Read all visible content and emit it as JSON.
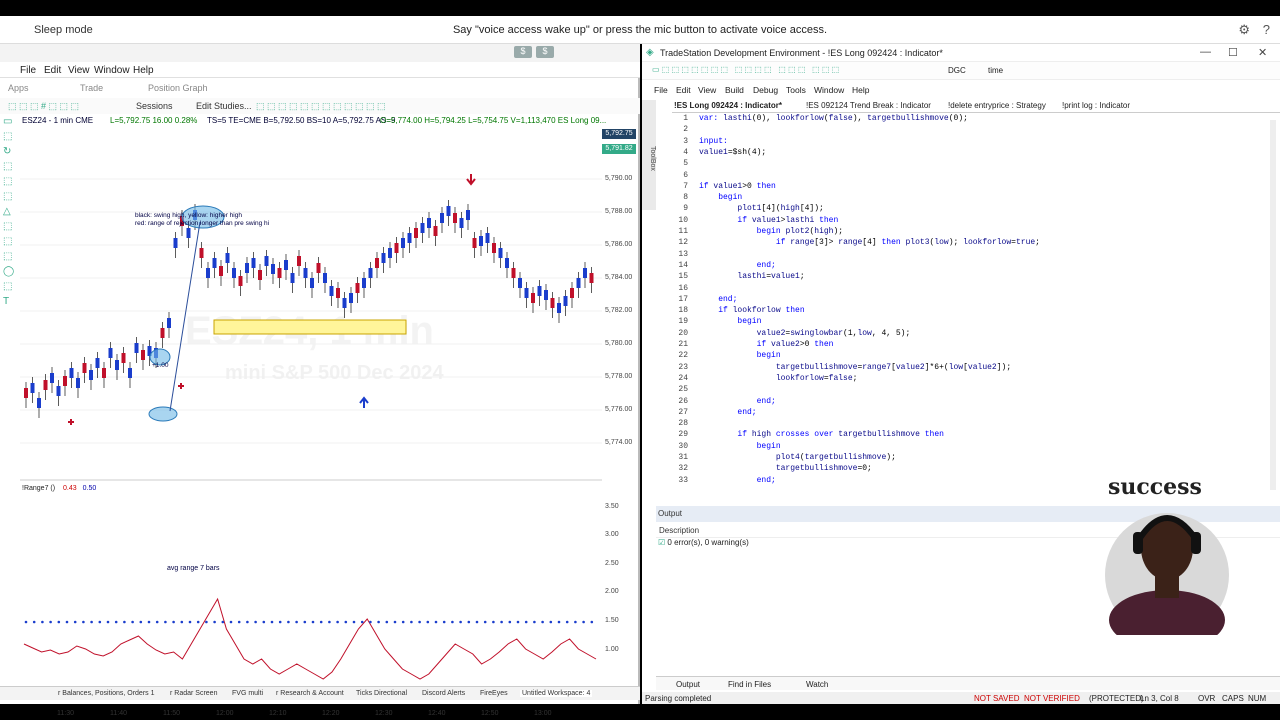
{
  "voice": {
    "sleep": "Sleep mode",
    "message": "Say \"voice access wake up\" or press the mic button to activate voice access.",
    "gear": "⚙",
    "help": "?"
  },
  "left": {
    "btn1": "$",
    "btn2": "$",
    "menu": [
      "File",
      "Edit",
      "View",
      "Window",
      "Help"
    ],
    "apps": [
      "Apps",
      "Trade",
      "Position Graph"
    ],
    "toolbar": [
      "Sessions",
      "Edit Studies..."
    ],
    "symbol": "ESZ24 - 1 min  CME",
    "quote_last": "L=5,792.75  16.00  0.28%",
    "quote_rest": "TS=5   TE=CME  B=5,792.50  BS=10    A=5,792.75  AS=9",
    "quote_ohlc": "O=5,774.00  H=5,794.25  L=5,754.75  V=1,113,470  ES Long 09...",
    "price_box1": "5,792.75",
    "price_box2": "5,791.82",
    "prices": [
      "5,790.00",
      "5,788.00",
      "5,786.00",
      "5,784.00",
      "5,782.00",
      "5,780.00",
      "5,778.00",
      "5,776.00",
      "5,774.00"
    ],
    "indicator": "!Range7 ()",
    "ind_v1": "0.43",
    "ind_v2": "0.50",
    "ind_prices": [
      "3.50",
      "3.00",
      "2.50",
      "2.00",
      "1.50",
      "1.00"
    ],
    "times": [
      "11:30",
      "11:40",
      "11:50",
      "12:00",
      "12:10",
      "12:20",
      "12:30",
      "12:40",
      "12:50",
      "13:00"
    ],
    "annot1": "black: swing high, yellow: higher high",
    "annot2": "red: range of rejection longer than pre swing hi",
    "annot3": "+1.00",
    "annot_avg": "avg range 7 bars",
    "watermark": "ESZ24, 1 min",
    "watermark2": "mini S&P 500 Dec 2024",
    "tabs": [
      "r Balances, Positions, Orders 1",
      "r Radar Screen",
      "FVG multi",
      "r Research & Account",
      "Ticks Directional",
      "Discord Alerts",
      "FireEyes",
      "Untitled Workspace: 4"
    ]
  },
  "right": {
    "title": "TradeStation Development Environment - !ES Long 092424 : Indicator*",
    "toolbar_text": [
      "DGC",
      "time"
    ],
    "menu": [
      "File",
      "Edit",
      "View",
      "Build",
      "Debug",
      "Tools",
      "Window",
      "Help"
    ],
    "tabs": [
      "!ES Long 092424 : Indicator*",
      "!ES 092124 Trend Break : Indicator",
      "!delete entryprice : Strategy",
      "!print log : Indicator"
    ],
    "vtab1": "ToolBox",
    "vtab2": "Resource View",
    "code": [
      {
        "n": "1",
        "t": "var: lasthi(0), lookforlow(false), targetbullishmove(0);"
      },
      {
        "n": "2",
        "t": ""
      },
      {
        "n": "3",
        "t": "input:"
      },
      {
        "n": "4",
        "t": "value1=$sh(4);"
      },
      {
        "n": "5",
        "t": ""
      },
      {
        "n": "6",
        "t": ""
      },
      {
        "n": "7",
        "t": "if value1>0 then"
      },
      {
        "n": "8",
        "t": "    begin"
      },
      {
        "n": "9",
        "t": "        plot1[4](high[4]);"
      },
      {
        "n": "10",
        "t": "        if value1>lasthi then"
      },
      {
        "n": "11",
        "t": "            begin plot2(high);"
      },
      {
        "n": "12",
        "t": "                if range[3]> range[4] then plot3(low); lookforlow=true;"
      },
      {
        "n": "13",
        "t": ""
      },
      {
        "n": "14",
        "t": "            end;"
      },
      {
        "n": "15",
        "t": "        lasthi=value1;"
      },
      {
        "n": "16",
        "t": ""
      },
      {
        "n": "17",
        "t": "    end;"
      },
      {
        "n": "18",
        "t": "    if lookforlow then"
      },
      {
        "n": "19",
        "t": "        begin"
      },
      {
        "n": "20",
        "t": "            value2=swinglowbar(1,low, 4, 5);"
      },
      {
        "n": "21",
        "t": "            if value2>0 then"
      },
      {
        "n": "22",
        "t": "            begin"
      },
      {
        "n": "23",
        "t": "                targetbullishmove=range7[value2]*6+(low[value2]);"
      },
      {
        "n": "24",
        "t": "                lookforlow=false;"
      },
      {
        "n": "25",
        "t": ""
      },
      {
        "n": "26",
        "t": "            end;"
      },
      {
        "n": "27",
        "t": "        end;"
      },
      {
        "n": "28",
        "t": ""
      },
      {
        "n": "29",
        "t": "        if high crosses over targetbullishmove then"
      },
      {
        "n": "30",
        "t": "            begin"
      },
      {
        "n": "31",
        "t": "                plot4(targetbullishmove);"
      },
      {
        "n": "32",
        "t": "                targetbullishmove=0;"
      },
      {
        "n": "33",
        "t": "            end;"
      }
    ],
    "output_label": "Output",
    "description": "Description",
    "errors": "0 error(s), 0 warning(s)",
    "output_tabs": [
      "Output",
      "Find in Files",
      "Watch"
    ],
    "status": "Parsing completed",
    "status_right": [
      "NOT SAVED",
      "NOT VERIFIED",
      "(PROTECTED)",
      "Ln 3, Col 8",
      "OVR",
      "CAPS",
      "NUM"
    ],
    "cam_text": "success"
  }
}
